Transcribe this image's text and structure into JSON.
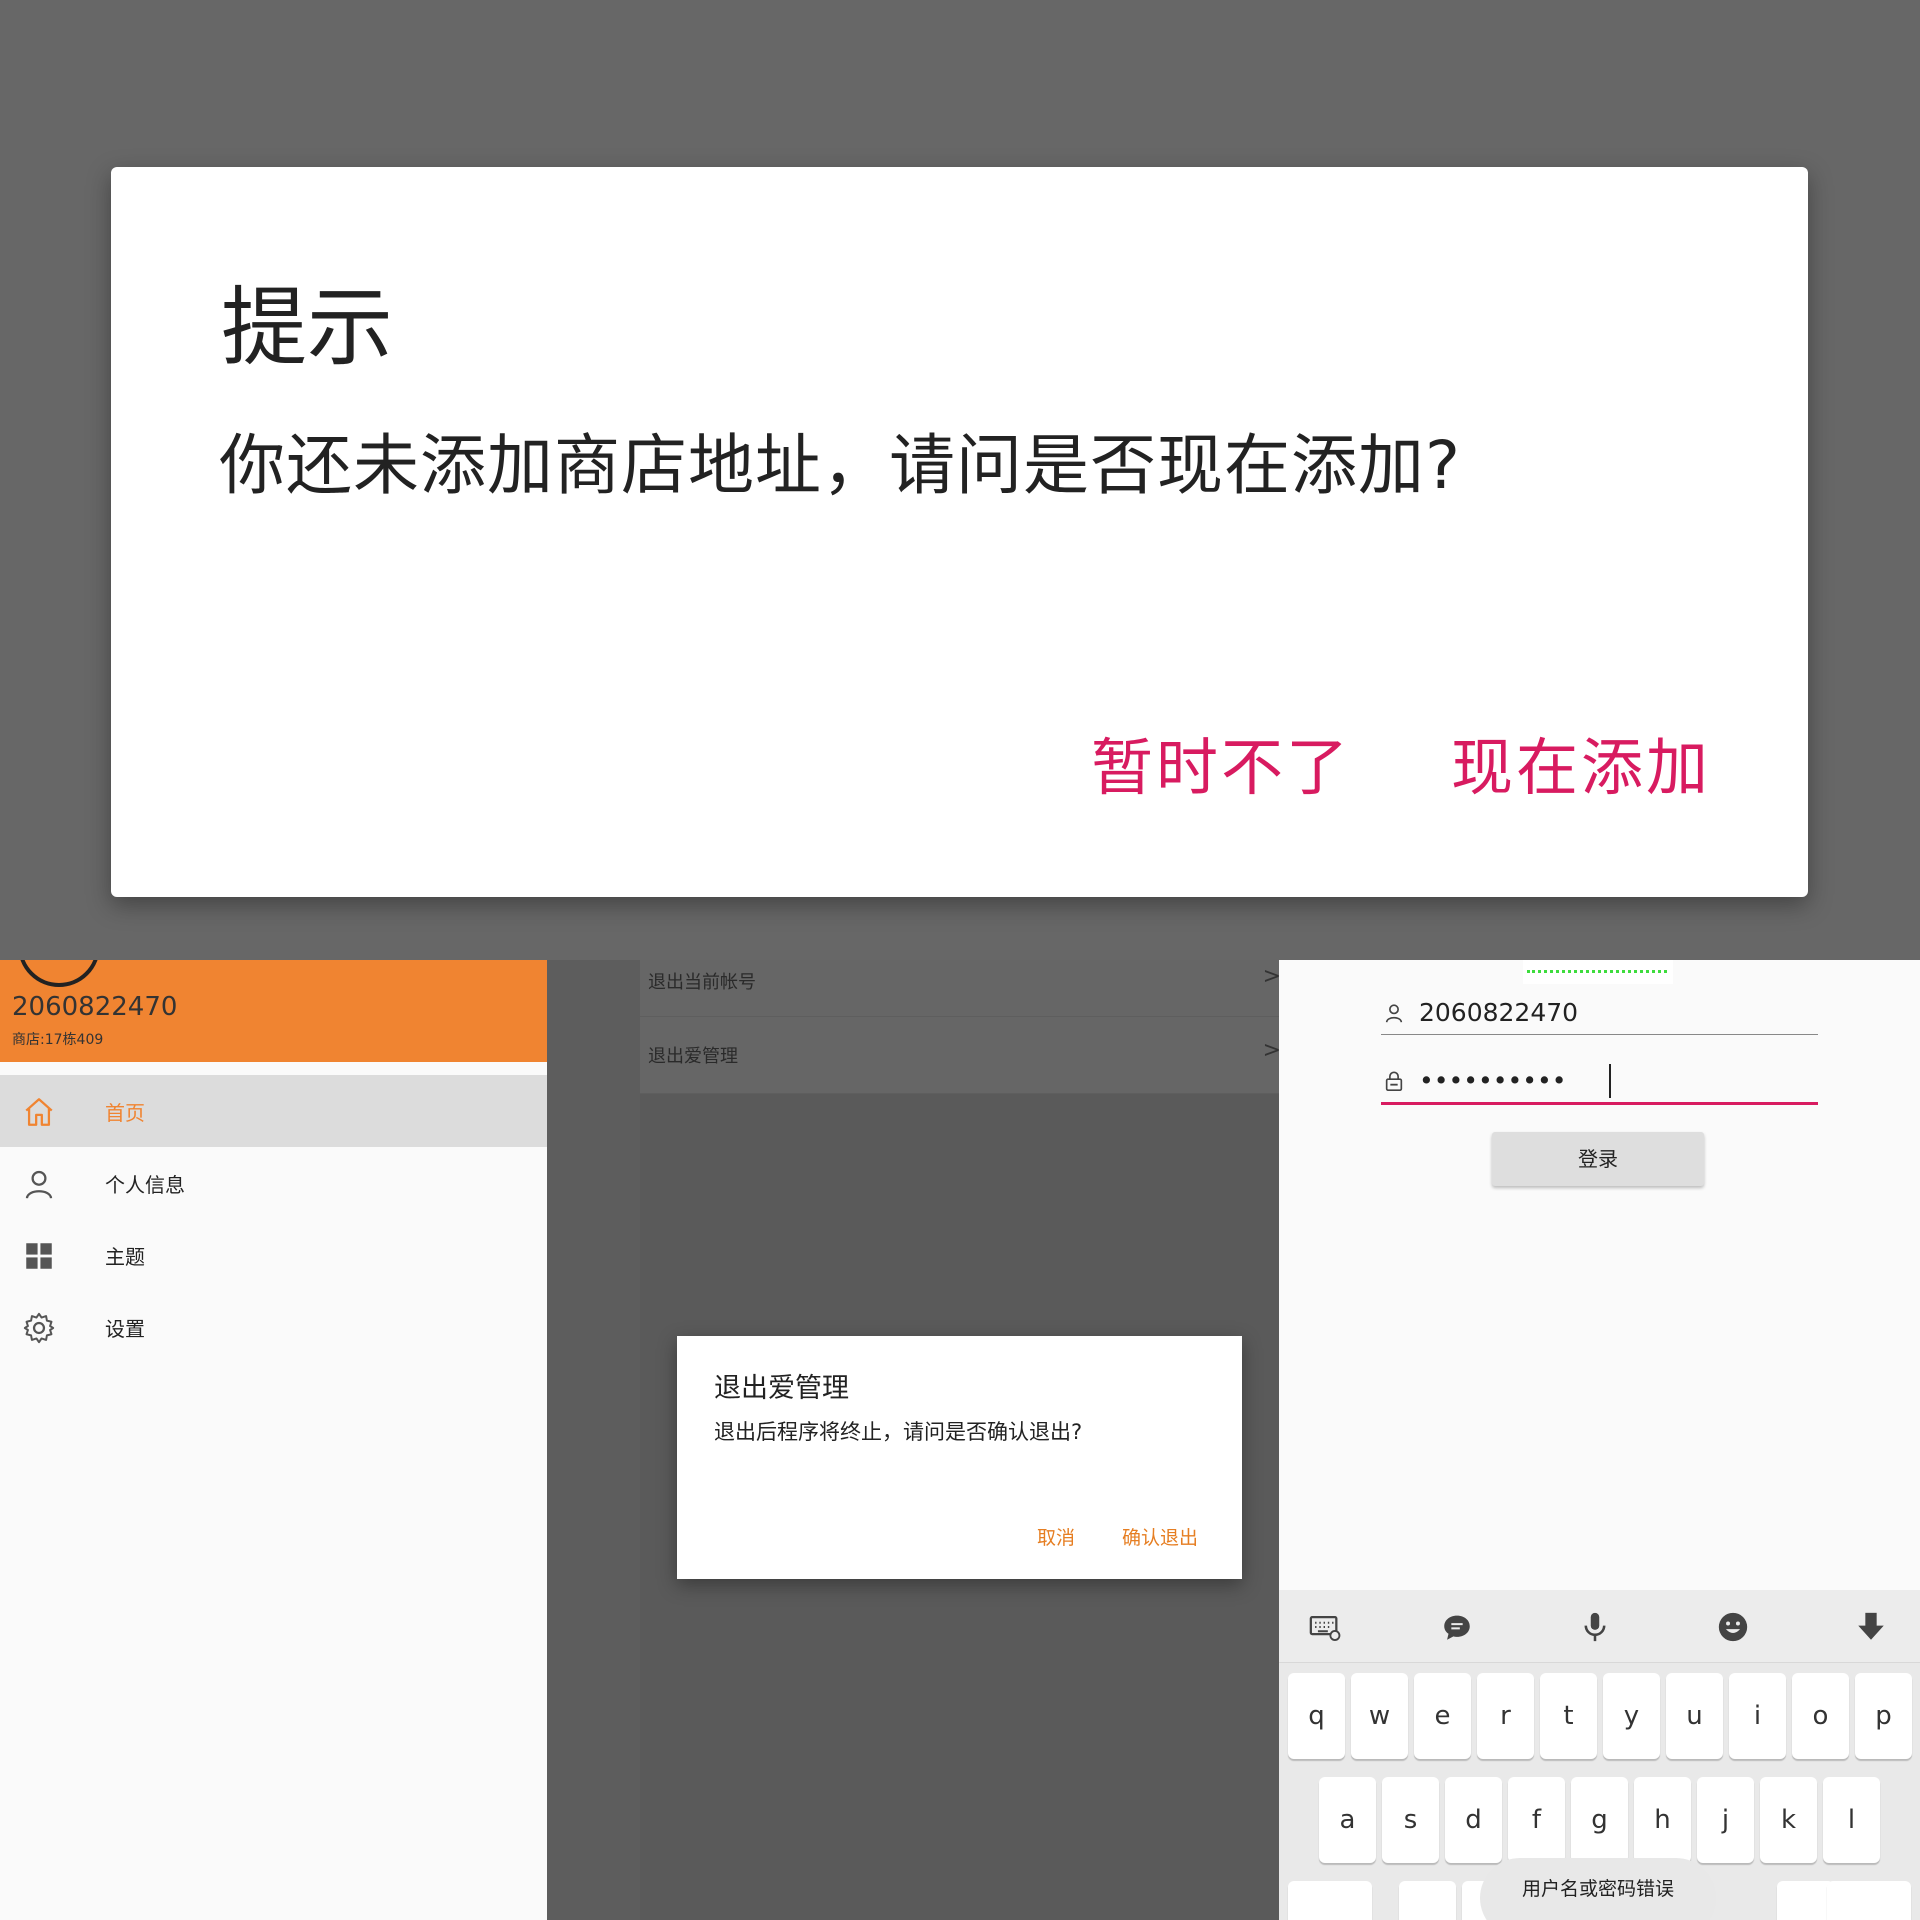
{
  "address_dialog": {
    "title": "提示",
    "message": "你还未添加商店地址，请问是否现在添加?",
    "btn_later": "暂时不了",
    "btn_add_now": "现在添加"
  },
  "drawer": {
    "user_id": "2060822470",
    "store": "商店:17栋409",
    "items": [
      {
        "label": "首页",
        "icon": "home-icon",
        "active": true
      },
      {
        "label": "个人信息",
        "icon": "person-icon"
      },
      {
        "label": "主题",
        "icon": "grid-icon"
      },
      {
        "label": "设置",
        "icon": "gear-icon"
      }
    ],
    "header_color": "#f08431"
  },
  "settings": {
    "rows": [
      {
        "label": "退出当前帐号"
      },
      {
        "label": "退出爱管理"
      }
    ],
    "chevron": ">",
    "exit_dialog": {
      "title": "退出爱管理",
      "message": "退出后程序将终止，请问是否确认退出?",
      "cancel": "取消",
      "confirm": "确认退出"
    }
  },
  "login": {
    "username": "2060822470",
    "password_mask": "••••••••••",
    "login_label": "登录",
    "toast": "用户名或密码错误",
    "accent_color": "#d81b60"
  },
  "keyboard": {
    "row1": [
      "q",
      "w",
      "e",
      "r",
      "t",
      "y",
      "u",
      "i",
      "o",
      "p"
    ],
    "row2": [
      "a",
      "s",
      "d",
      "f",
      "g",
      "h",
      "j",
      "k",
      "l"
    ],
    "toolbar_icons": [
      "keyboard-settings-icon",
      "chat-bubble-icon",
      "microphone-icon",
      "emoji-icon",
      "hide-keyboard-icon"
    ]
  }
}
